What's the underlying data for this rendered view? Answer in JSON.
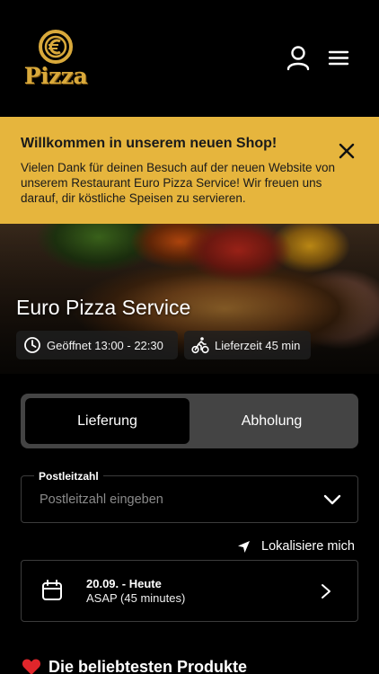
{
  "header": {
    "logo_text": "Pizza",
    "icons": {
      "account": "user-icon",
      "menu": "hamburger-menu-icon",
      "logo_emblem": "euro-emblem-icon"
    }
  },
  "banner": {
    "title": "Willkommen in unserem neuen Shop!",
    "text": "Vielen Dank für deinen Besuch auf der neuen Website von unserem Restaurant Euro Pizza Service! Wir freuen uns darauf, dir köstliche Speisen zu servieren.",
    "close_icon": "close-icon"
  },
  "hero": {
    "restaurant_name": "Euro Pizza Service",
    "opening_hours": "Geöffnet 13:00 - 22:30",
    "delivery_time": "Lieferzeit 45 min"
  },
  "order_mode": {
    "options": [
      "Lieferung",
      "Abholung"
    ],
    "selected": "Lieferung"
  },
  "zip": {
    "label": "Postleitzahl",
    "placeholder": "Postleitzahl eingeben",
    "value": ""
  },
  "locate": {
    "label": "Lokalisiere mich"
  },
  "schedule": {
    "date": "20.09. - Heute",
    "time": "ASAP (45 minutes)"
  },
  "popular": {
    "heading": "Die beliebtesten Produkte"
  },
  "colors": {
    "banner_bg": "#e6b53d",
    "logo_gold": "#d9a93b",
    "toggle_bg": "#444444",
    "background": "#000000",
    "heart": "#e0262b"
  }
}
